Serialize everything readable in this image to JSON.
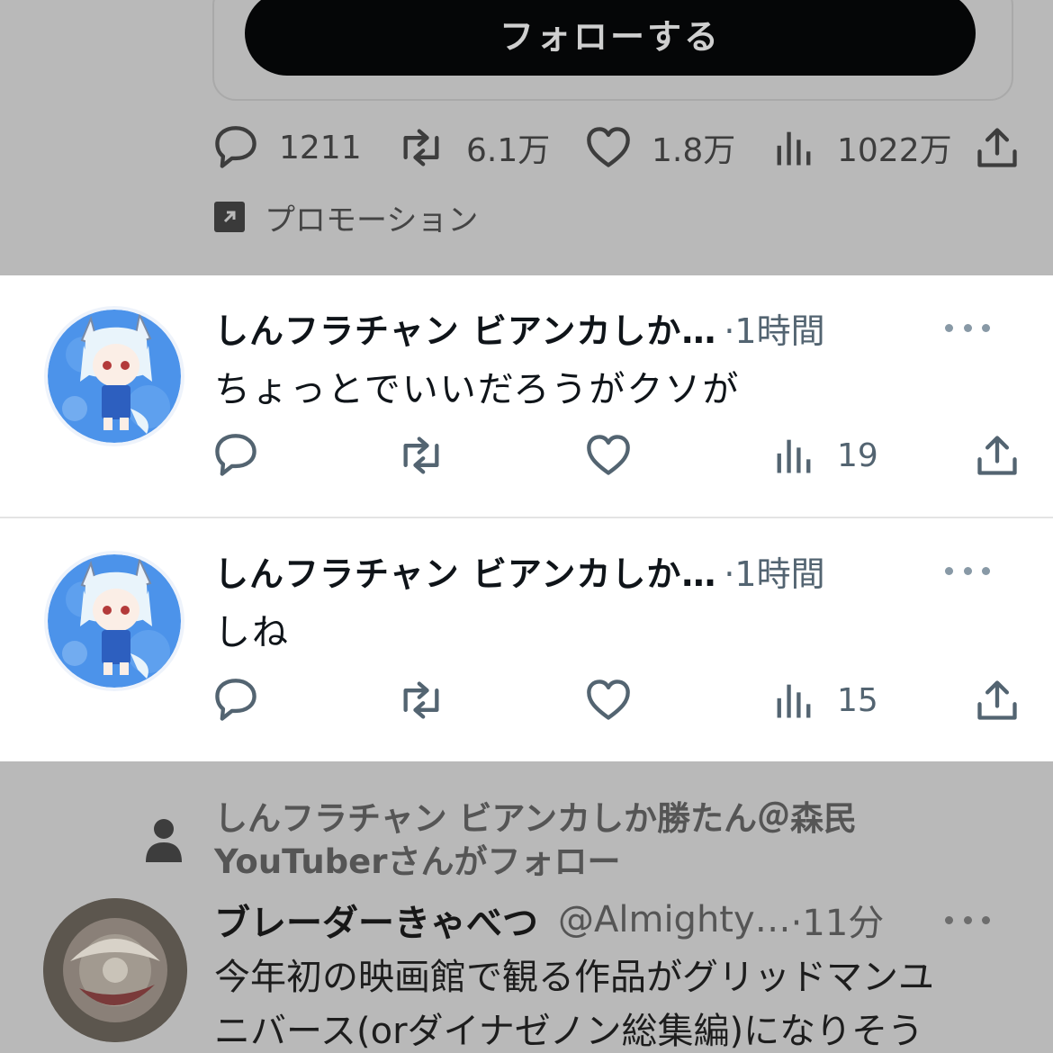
{
  "promo_tweet": {
    "follow_button": "フォローする",
    "replies": "1211",
    "retweets": "6.1万",
    "likes": "1.8万",
    "views": "1022万",
    "promoted_label": "プロモーション"
  },
  "replies": [
    {
      "name": "しんフラチャン ビアンカしか…",
      "time": "·1時間",
      "text": "ちょっとでいいだろうがクソが",
      "views": "19"
    },
    {
      "name": "しんフラチャン ビアンカしか…",
      "time": "·1時間",
      "text": "しね",
      "views": "15"
    }
  ],
  "next_tweet": {
    "follow_context_line1": "しんフラチャン ビアンカしか勝たん＠森民",
    "follow_context_line2": "YouTuberさんがフォロー",
    "name": "ブレーダーきゃべつ",
    "handle": "@Almighty…",
    "time": "·11分",
    "text_line1": "今年初の映画館で観る作品がグリッドマンユ",
    "text_line2": "ニバース(orダイナゼノン総集編)になりそう"
  }
}
